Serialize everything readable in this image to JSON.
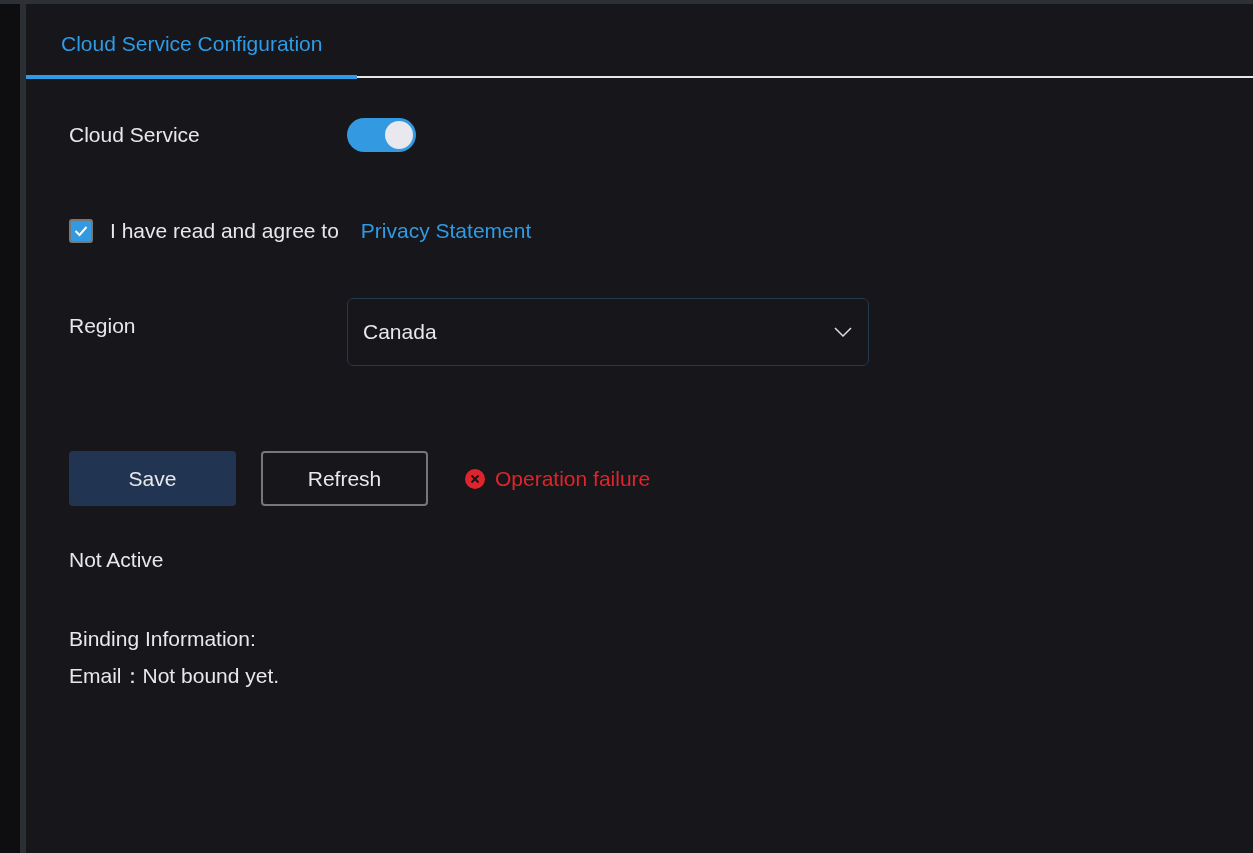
{
  "tabs": [
    {
      "label": "Cloud Service Configuration",
      "selected": true
    }
  ],
  "cloud_service": {
    "label": "Cloud Service",
    "on": true
  },
  "agreement": {
    "checked": true,
    "text": "I have read and agree to",
    "link": "Privacy Statement"
  },
  "region": {
    "label": "Region",
    "value": "Canada"
  },
  "buttons": [
    {
      "label": "Save",
      "kind": "primary"
    },
    {
      "label": "Refresh",
      "kind": "secondary"
    }
  ],
  "status_message": {
    "kind": "error",
    "text": "Operation failure"
  },
  "activation_status": "Not Active",
  "binding": {
    "heading": "Binding Information:",
    "email_label": "Email：",
    "email_value": "Not bound yet."
  }
}
